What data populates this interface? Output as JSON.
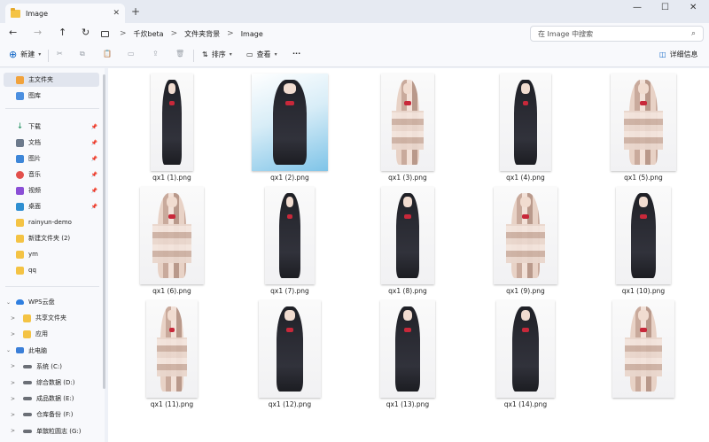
{
  "tab": {
    "title": "Image",
    "close": "✕",
    "new": "+"
  },
  "window_controls": {
    "minimize": "—",
    "maximize": "☐",
    "close": "✕"
  },
  "nav": {
    "back": "←",
    "forward": "→",
    "up": "↑",
    "refresh": "↻"
  },
  "breadcrumb": [
    "千炊beta",
    "文件夹背景",
    "Image"
  ],
  "breadcrumb_sep": ">",
  "search": {
    "placeholder": "在 Image 中搜索",
    "icon": "⌕"
  },
  "toolbar": {
    "new_label": "新建",
    "sort_label": "排序",
    "view_label": "查看",
    "more": "···",
    "details_label": "详细信息",
    "icons": {
      "cut": "✂",
      "copy": "⧉",
      "paste": "📋",
      "rename": "▭",
      "share": "⇪",
      "delete": "🗑"
    }
  },
  "sidebar": {
    "quick": [
      {
        "label": "主文件夹",
        "icon": "home",
        "selected": true
      },
      {
        "label": "图库",
        "icon": "gallery"
      }
    ],
    "pinned": [
      {
        "label": "下载",
        "icon": "download",
        "pin": "📌"
      },
      {
        "label": "文档",
        "icon": "doc",
        "pin": "📌"
      },
      {
        "label": "图片",
        "icon": "pic",
        "pin": "📌"
      },
      {
        "label": "音乐",
        "icon": "music",
        "pin": "📌"
      },
      {
        "label": "视频",
        "icon": "video",
        "pin": "📌"
      },
      {
        "label": "桌面",
        "icon": "desk",
        "pin": "📌"
      },
      {
        "label": "rainyun-demo",
        "icon": "folder"
      },
      {
        "label": "新建文件夹 (2)",
        "icon": "folder"
      },
      {
        "label": "ym",
        "icon": "folder"
      },
      {
        "label": "qq",
        "icon": "folder"
      }
    ],
    "tree": [
      {
        "label": "WPS云盘",
        "icon": "cloud",
        "chevron": "⌄",
        "level": 0
      },
      {
        "label": "共享文件夹",
        "icon": "folder",
        "chevron": ">",
        "level": 1
      },
      {
        "label": "应用",
        "icon": "folder",
        "chevron": ">",
        "level": 1
      },
      {
        "label": "此电脑",
        "icon": "pc",
        "chevron": "⌄",
        "level": 0
      },
      {
        "label": "系统 (C:)",
        "icon": "drive",
        "chevron": ">",
        "level": 1
      },
      {
        "label": "综合数据 (D:)",
        "icon": "drive",
        "chevron": ">",
        "level": 1
      },
      {
        "label": "成品数据 (E:)",
        "icon": "drive",
        "chevron": ">",
        "level": 1
      },
      {
        "label": "仓库备份 (F:)",
        "icon": "drive",
        "chevron": ">",
        "level": 1
      },
      {
        "label": "单髌粒圆志 (G:)",
        "icon": "drive",
        "chevron": ">",
        "level": 1
      }
    ]
  },
  "files": [
    {
      "name": "qx1 (1).png",
      "style": "plain"
    },
    {
      "name": "qx1 (2).png",
      "style": "blue"
    },
    {
      "name": "qx1 (3).png",
      "style": "pix"
    },
    {
      "name": "qx1 (4).png",
      "style": "plain"
    },
    {
      "name": "qx1 (5).png",
      "style": "pix"
    },
    {
      "name": "qx1 (6).png",
      "style": "pix"
    },
    {
      "name": "qx1 (7).png",
      "style": "plain"
    },
    {
      "name": "qx1 (8).png",
      "style": "plain"
    },
    {
      "name": "qx1 (9).png",
      "style": "pix"
    },
    {
      "name": "qx1 (10).png",
      "style": "plain"
    },
    {
      "name": "qx1 (11).png",
      "style": "pix"
    },
    {
      "name": "qx1 (12).png",
      "style": "plain"
    },
    {
      "name": "qx1 (13).png",
      "style": "plain"
    },
    {
      "name": "qx1 (14).png",
      "style": "plain"
    },
    {
      "name": "",
      "style": "pix"
    }
  ]
}
